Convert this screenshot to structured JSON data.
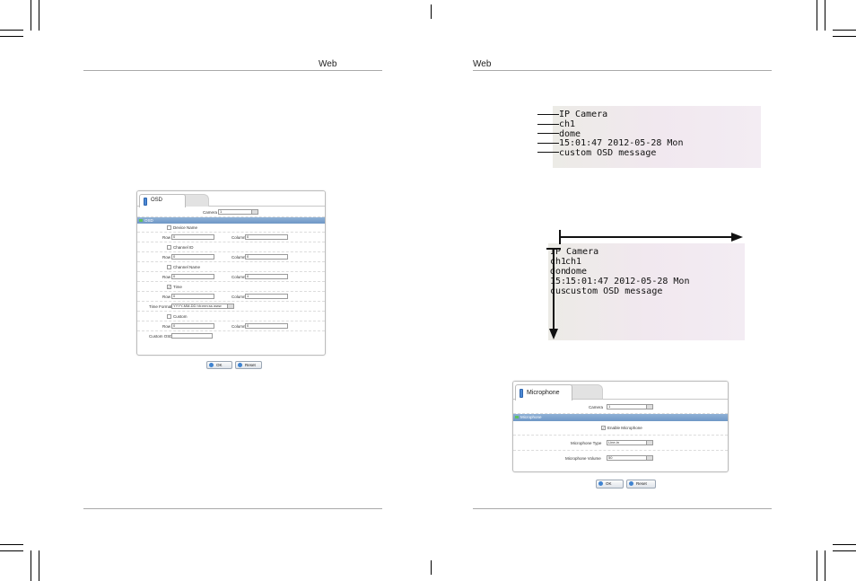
{
  "left_page": {
    "header": "Web",
    "osd_panel": {
      "tab_label": "OSD",
      "camera_label": "Camera",
      "camera_value": "1",
      "section_title": "OSD",
      "device_name_label": "Device Name",
      "channel_id_label": "Channel ID",
      "channel_name_label": "Channel Name",
      "time_label": "Time",
      "custom_label": "Custom",
      "row_label": "Row",
      "column_label": "Column",
      "device_row": "0",
      "device_col": "0",
      "chid_row": "0",
      "chid_col": "0",
      "chname_row": "0",
      "chname_col": "0",
      "time_row": "0",
      "time_col": "1",
      "custom_row": "0",
      "custom_col": "0",
      "time_format_label": "Time Format",
      "time_format_value": "YYYY-MM-DD hh:mm:ss www",
      "custom_osd_label": "Custom OSD",
      "custom_osd_value": "",
      "time_checked": "✓",
      "ok_label": "OK",
      "reset_label": "Reset"
    }
  },
  "right_page": {
    "header": "Web",
    "osd_preview_1": [
      "IP Camera",
      "ch1",
      "dome",
      "15:01:47 2012-05-28 Mon",
      "custom OSD message"
    ],
    "osd_preview_2": {
      "ghost_left": [
        "",
        "ch1",
        "don",
        "15:",
        "cus"
      ],
      "lines": [
        "IP Camera",
        "ch1",
        "dome",
        "15:01:47 2012-05-28 Mon",
        "custom OSD message"
      ]
    },
    "mic_panel": {
      "tab_label": "Microphone",
      "camera_label": "Camera",
      "camera_value": "1",
      "section_title": "Microphone",
      "enable_label": "Enable Microphone",
      "enable_checked": "✓",
      "type_label": "Microphone Type",
      "type_value": "Line-in",
      "volume_label": "Microphone Volume",
      "volume_value": "50",
      "ok_label": "OK",
      "reset_label": "Reset"
    }
  }
}
